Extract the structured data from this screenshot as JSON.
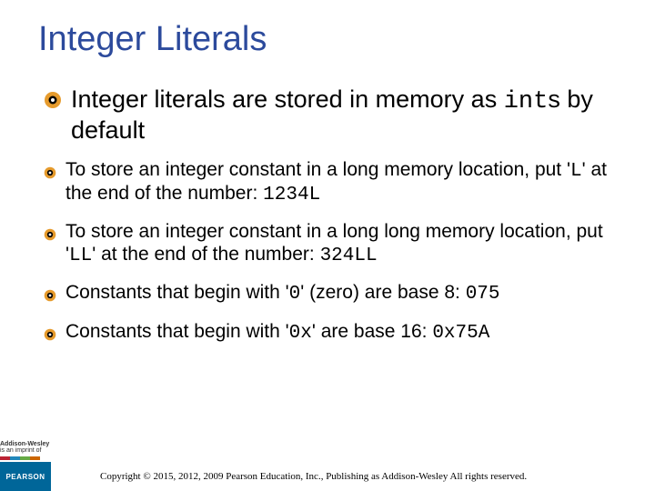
{
  "title": "Integer Literals",
  "bullets": {
    "b1_pre": "Integer literals are stored in memory as ",
    "b1_code": "int",
    "b1_post": "s by default",
    "b2_pre": "To store an integer constant in a long memory location, put '",
    "b2_code1": "L",
    "b2_mid": "' at the end of the number:   ",
    "b2_code2": "1234L",
    "b3_pre": "To store an integer constant in a long long memory location, put '",
    "b3_code1": "LL",
    "b3_mid": "' at the end of the number:   ",
    "b3_code2": "324LL",
    "b4_pre": "Constants that begin with '",
    "b4_code1": "0",
    "b4_mid": "' (zero) are base 8:   ",
    "b4_code2": "075",
    "b5_pre": "Constants that begin with '",
    "b5_code1": "0x",
    "b5_mid": "' are base 16:   ",
    "b5_code2": "0x75A"
  },
  "footer": {
    "brand_top_line1": "Addison-Wesley",
    "brand_top_line2": "is an imprint of",
    "brand_block": "PEARSON",
    "copyright": "Copyright © 2015, 2012, 2009 Pearson Education, Inc., Publishing as Addison-Wesley All rights reserved."
  }
}
